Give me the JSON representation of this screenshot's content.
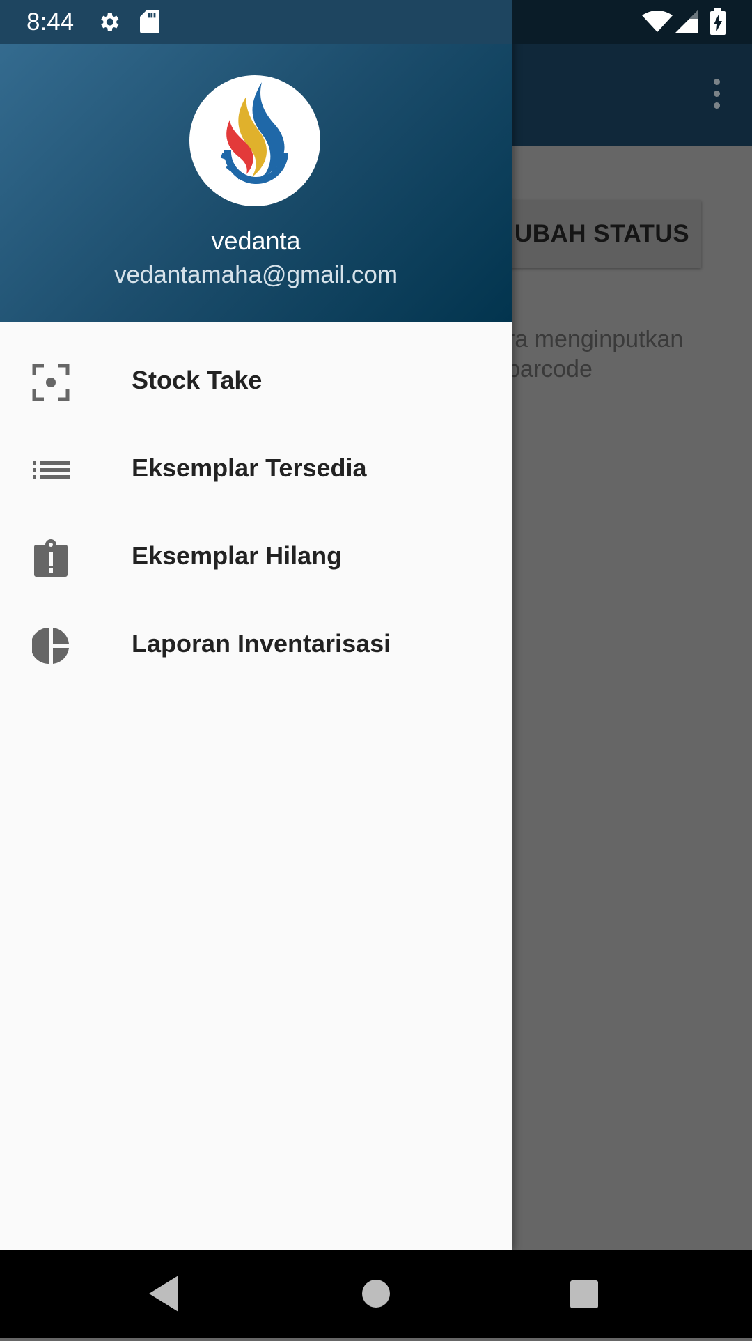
{
  "status_bar": {
    "time": "8:44",
    "icons": [
      "settings-icon",
      "sd-card-icon",
      "wifi-icon",
      "signal-icon",
      "battery-charging-icon"
    ]
  },
  "app_bar": {
    "overflow_icon": "more-vert-icon"
  },
  "background_screen": {
    "status_button_label": "UBAH STATUS",
    "hint_line1": "ra menginputkan",
    "hint_line2": " barcode"
  },
  "drawer": {
    "header": {
      "user_name": "vedanta",
      "user_email": "vedantamaha@gmail.com"
    },
    "items": [
      {
        "label": "Stock Take",
        "icon": "scan-focus-icon"
      },
      {
        "label": "Eksemplar Tersedia",
        "icon": "list-icon"
      },
      {
        "label": "Eksemplar Hilang",
        "icon": "clipboard-alert-icon"
      },
      {
        "label": "Laporan Inventarisasi",
        "icon": "pie-chart-icon"
      }
    ]
  },
  "nav_bar": {
    "buttons": [
      "back-icon",
      "home-icon",
      "recents-icon"
    ]
  },
  "colors": {
    "header_start": "#346b8f",
    "header_end": "#02344e",
    "drawer_bg": "#fafafa",
    "scrim": "#666666"
  }
}
